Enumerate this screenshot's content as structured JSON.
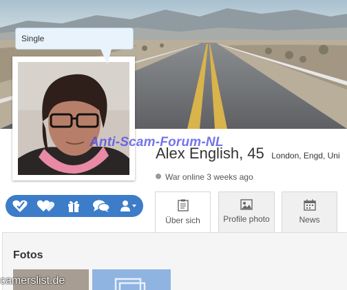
{
  "profile": {
    "relationship_status": "Single",
    "name": "Alex English, 45",
    "location": "London, Engd, Uni",
    "online_status": "War online 3 weeks ago"
  },
  "actions": [
    {
      "icon": "favorite-check-icon"
    },
    {
      "icon": "hearts-icon"
    },
    {
      "icon": "gift-icon"
    },
    {
      "icon": "chat-icon"
    },
    {
      "icon": "user-menu-icon"
    }
  ],
  "tabs": [
    {
      "label": "Über sich",
      "icon": "clipboard-icon",
      "active": true
    },
    {
      "label": "Profile photo",
      "icon": "photo-icon",
      "active": false
    },
    {
      "label": "News",
      "icon": "calendar-icon",
      "active": false
    }
  ],
  "sections": {
    "fotos_title": "Fotos"
  },
  "watermarks": {
    "top": "Anti-Scam-Forum-NL",
    "bottom": "camerslist.de"
  },
  "colors": {
    "accent": "#3d7cc9",
    "bubble": "#e9f3fb",
    "watermark_top": "#4646e6"
  }
}
